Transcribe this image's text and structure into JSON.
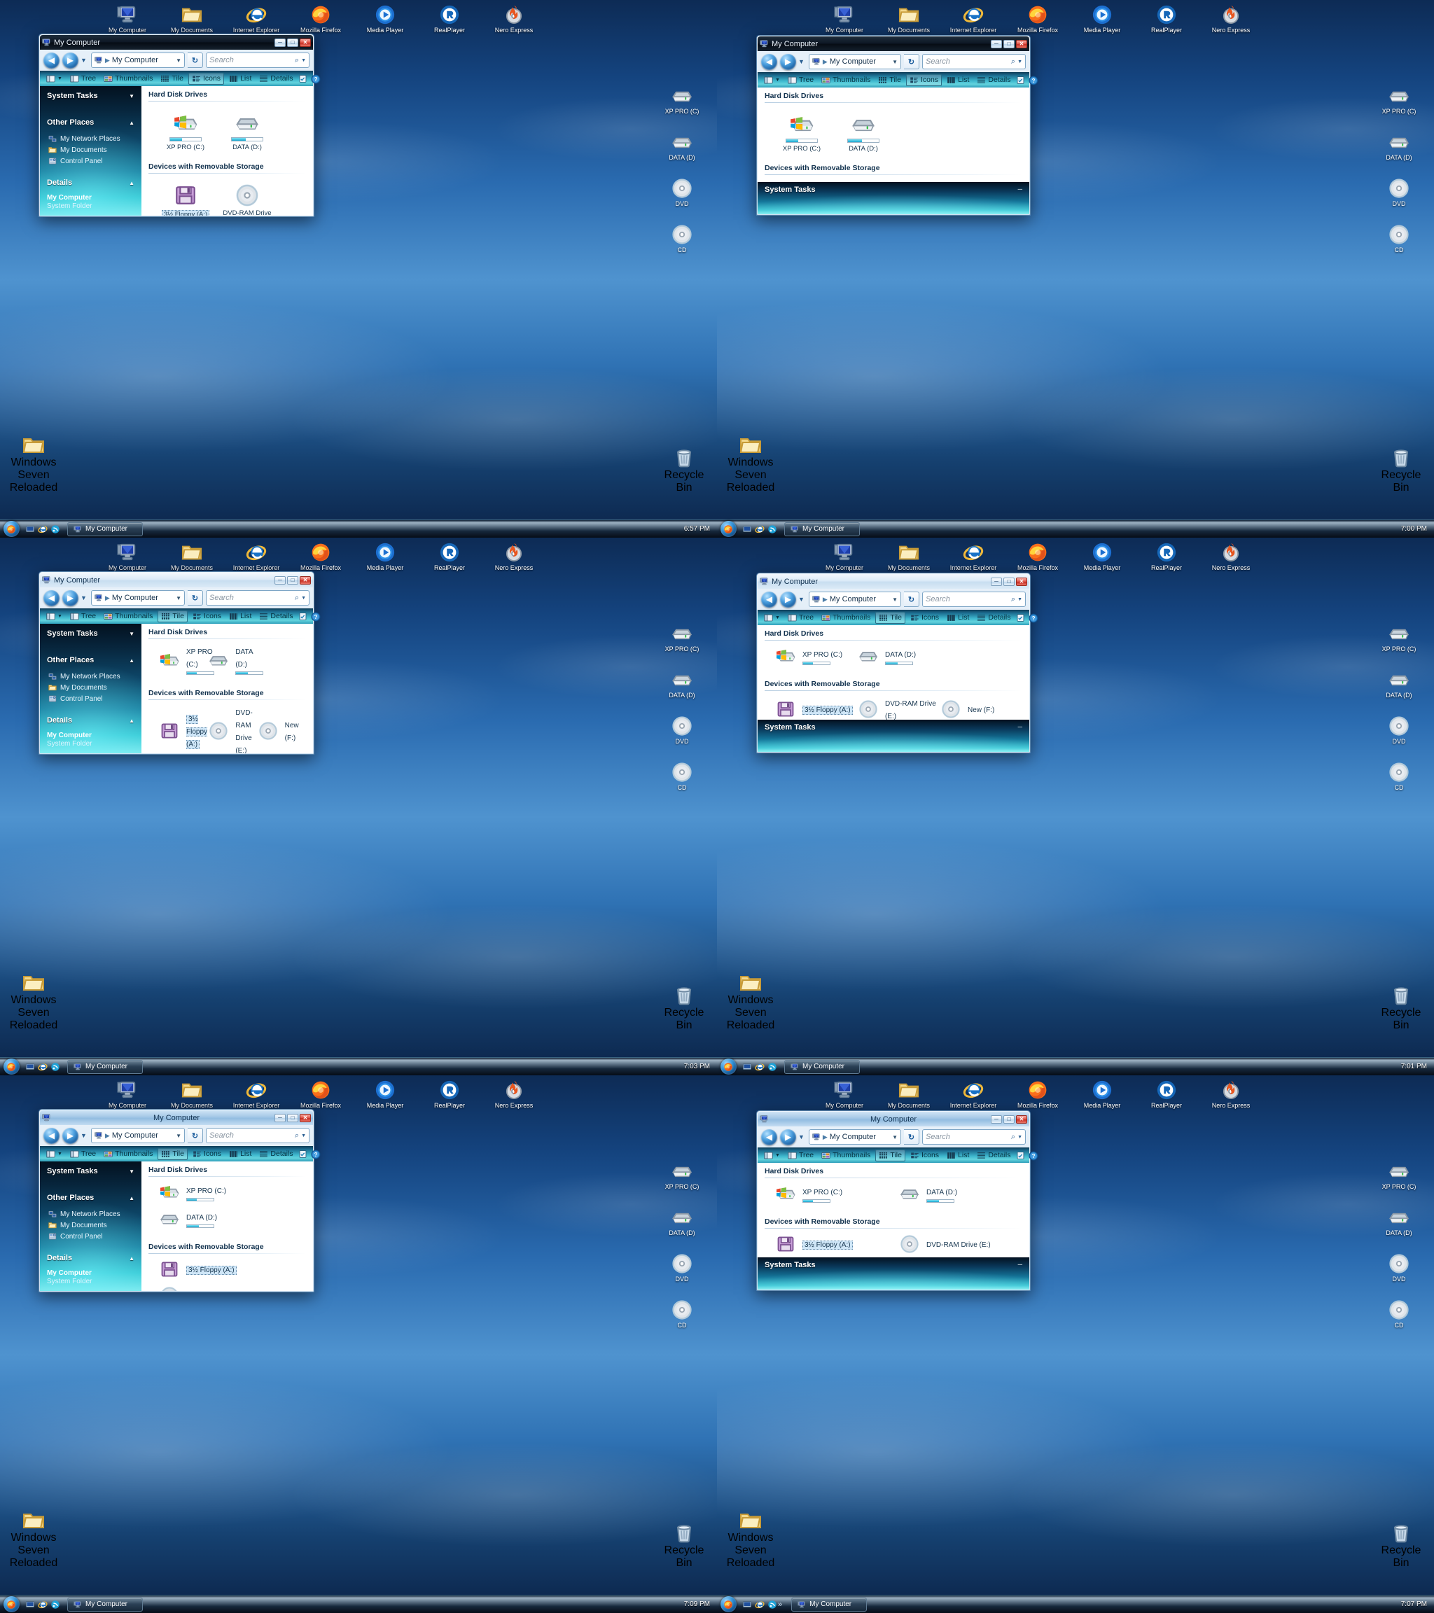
{
  "desktop": {
    "top_icons": [
      {
        "name": "My Computer",
        "icon": "monitor-icon"
      },
      {
        "name": "My Documents",
        "icon": "folder-icon"
      },
      {
        "name": "Internet Explorer",
        "icon": "ie-icon"
      },
      {
        "name": "Mozilla Firefox",
        "icon": "firefox-icon"
      },
      {
        "name": "Media Player",
        "icon": "media-player-icon"
      },
      {
        "name": "RealPlayer",
        "icon": "realplayer-icon"
      },
      {
        "name": "Nero Express",
        "icon": "nero-icon"
      }
    ],
    "right_icons": [
      {
        "name": "XP PRO (C)",
        "icon": "hard-drive-icon"
      },
      {
        "name": "DATA (D)",
        "icon": "hard-drive-icon"
      },
      {
        "name": "DVD",
        "icon": "optical-disc-icon"
      },
      {
        "name": "CD",
        "icon": "optical-disc-icon"
      }
    ],
    "bottom_left_icon": {
      "name": "Windows Seven Reloaded",
      "icon": "folder-icon"
    },
    "bottom_right_icon": {
      "name": "Recycle Bin",
      "icon": "recycle-bin-icon"
    }
  },
  "taskbar": {
    "start_label": "Start",
    "quick_launch": [
      "show-desktop-icon",
      "ie-icon",
      "media-icon"
    ],
    "overflow_chevron": "»",
    "task_button": "My Computer"
  },
  "window": {
    "title": "My Computer",
    "address": "My Computer",
    "search_placeholder": "Search",
    "toolbar": [
      {
        "label": "Tree",
        "icon": "tree-pane-icon"
      },
      {
        "label": "Thumbnails",
        "icon": "thumbnails-icon"
      },
      {
        "label": "Tile",
        "icon": "tile-view-icon"
      },
      {
        "label": "Icons",
        "icon": "icons-view-icon"
      },
      {
        "label": "List",
        "icon": "list-view-icon"
      },
      {
        "label": "Details",
        "icon": "details-view-icon"
      }
    ],
    "toolbar_right": [
      {
        "name": "organize-icon"
      },
      {
        "name": "help-icon"
      }
    ],
    "sidebar": {
      "system_tasks": "System Tasks",
      "other_places": "Other Places",
      "places": [
        {
          "label": "My Network Places",
          "icon": "network-icon"
        },
        {
          "label": "My Documents",
          "icon": "folder-icon"
        },
        {
          "label": "Control Panel",
          "icon": "control-panel-icon"
        }
      ],
      "details": "Details",
      "details_name": "My Computer",
      "details_type": "System Folder"
    },
    "groups": {
      "hard_disks": "Hard Disk Drives",
      "removable": "Devices with Removable Storage"
    },
    "drives": [
      {
        "label": "XP PRO (C:)",
        "icon": "windows-drive-icon",
        "fill": 38
      },
      {
        "label": "DATA (D:)",
        "icon": "hard-drive-icon",
        "fill": 45
      }
    ],
    "removable": [
      {
        "label": "3½ Floppy (A:)",
        "icon": "floppy-icon",
        "selected": true
      },
      {
        "label": "DVD-RAM Drive (E:)",
        "icon": "optical-disc-icon",
        "selected": false
      },
      {
        "label": "New (F:)",
        "icon": "optical-disc-icon",
        "selected": false
      }
    ],
    "window_buttons": {
      "minimize": "─",
      "maximize": "□",
      "close": "✕"
    },
    "bottom_tasks_label": "System Tasks"
  },
  "panels": [
    {
      "id": "p1",
      "time": "6:57 PM",
      "view": "Icons",
      "title_style": "dark-left",
      "layout": "sidebar-left",
      "content": "icons"
    },
    {
      "id": "p2",
      "time": "7:00 PM",
      "view": "Icons",
      "title_style": "dark-left",
      "layout": "tasks-bottom",
      "content": "icons"
    },
    {
      "id": "p3",
      "time": "7:03 PM",
      "view": "Tile",
      "title_style": "light-left",
      "layout": "sidebar-left",
      "content": "tiles-3col"
    },
    {
      "id": "p4",
      "time": "7:01 PM",
      "view": "Tile",
      "title_style": "light-left",
      "layout": "tasks-bottom",
      "content": "tiles-3col"
    },
    {
      "id": "p5",
      "time": "7:09 PM",
      "view": "Tile",
      "title_style": "aero-center",
      "layout": "sidebar-left",
      "content": "tiles-1col"
    },
    {
      "id": "p6",
      "time": "7:07 PM",
      "view": "Tile",
      "title_style": "aero-center",
      "layout": "tasks-bottom",
      "content": "tiles-2col"
    }
  ]
}
